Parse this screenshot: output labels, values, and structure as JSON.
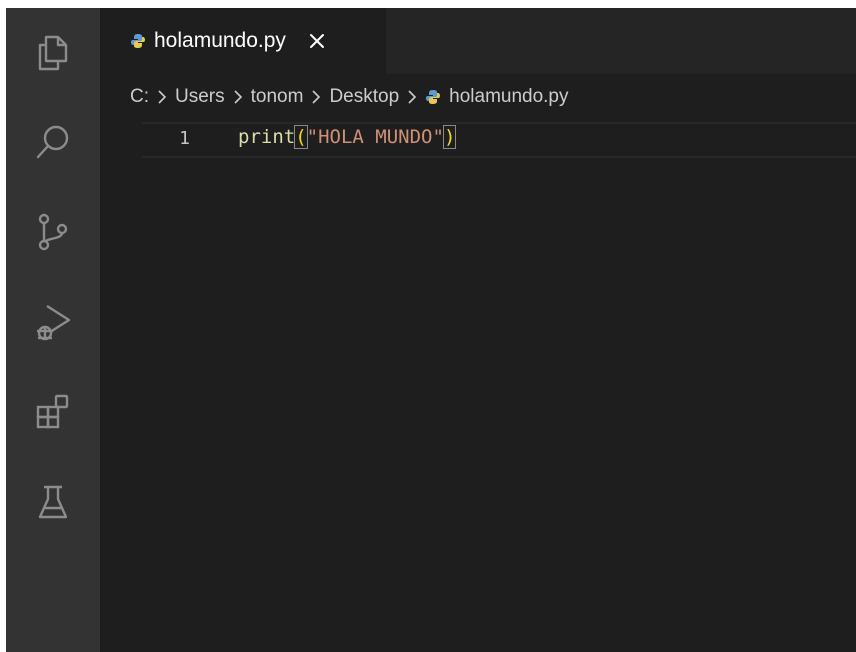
{
  "activity_bar": {
    "items": [
      {
        "name": "explorer",
        "icon": "files-icon"
      },
      {
        "name": "search",
        "icon": "search-icon"
      },
      {
        "name": "source-control",
        "icon": "source-control-icon"
      },
      {
        "name": "run-debug",
        "icon": "run-debug-icon"
      },
      {
        "name": "extensions",
        "icon": "extensions-icon"
      },
      {
        "name": "testing",
        "icon": "flask-icon"
      }
    ]
  },
  "tab": {
    "label": "holamundo.py",
    "icon": "python-file-icon",
    "close_icon": "close-icon"
  },
  "breadcrumb": {
    "items": [
      "C:",
      "Users",
      "tonom",
      "Desktop",
      "holamundo.py"
    ]
  },
  "editor": {
    "line_number": "1",
    "code": {
      "function": "print",
      "open_paren": "(",
      "string": "\"HOLA MUNDO\"",
      "close_paren": ")"
    }
  },
  "colors": {
    "activity_bar_bg": "#333333",
    "editor_bg": "#1e1e1e",
    "function": "#dcdcaa",
    "string": "#ce9178",
    "bracket": "#ffd700",
    "python_icon": "#5b9bd5"
  }
}
